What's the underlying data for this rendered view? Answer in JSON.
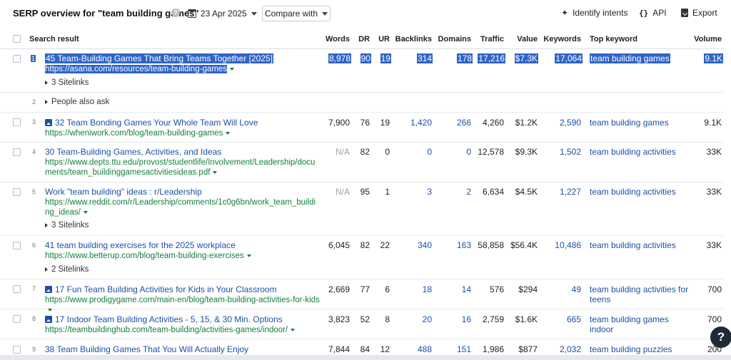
{
  "header": {
    "title": "SERP overview for \"team building games\"",
    "help_icon": "?",
    "date": "23 Apr 2025",
    "compare_label": "Compare with",
    "identify_label": "Identify intents",
    "api_label": "API",
    "api_icon_glyph": "{}",
    "export_label": "Export"
  },
  "columns": {
    "search_result": "Search result",
    "words": "Words",
    "dr": "DR",
    "ur": "UR",
    "backlinks": "Backlinks",
    "domains": "Domains",
    "traffic": "Traffic",
    "value": "Value",
    "keywords": "Keywords",
    "top_keyword": "Top keyword",
    "volume": "Volume"
  },
  "rows": [
    {
      "num": "1",
      "title": "45 Team-Building Games That Bring Teams Together [2025]",
      "url": "https://asana.com/resources/team-building-games",
      "sitelinks": "3 Sitelinks",
      "words": "8,978",
      "dr": "90",
      "ur": "19",
      "backlinks": "314",
      "domains": "178",
      "traffic": "17,216",
      "value": "$7.3K",
      "keywords": "17,064",
      "top_keyword": "team building games",
      "volume": "9.1K"
    },
    {
      "num": "2",
      "paa": "People also ask"
    },
    {
      "num": "3",
      "title": "32 Team Bonding Games Your Whole Team Will Love",
      "url": "https://wheniwork.com/blog/team-building-games",
      "words": "7,900",
      "dr": "76",
      "ur": "19",
      "backlinks": "1,420",
      "domains": "266",
      "traffic": "4,260",
      "value": "$1.2K",
      "keywords": "2,590",
      "top_keyword": "team building games",
      "volume": "9.1K"
    },
    {
      "num": "4",
      "title": "30 Team-Building Games, Activities, and Ideas",
      "url": "https://www.depts.ttu.edu/provost/studentlife/Involvement/Leadership/documents/team_buildinggamesactivitiesideas.pdf",
      "words": "N/A",
      "dr": "82",
      "ur": "0",
      "backlinks": "0",
      "domains": "0",
      "traffic": "12,578",
      "value": "$9.3K",
      "keywords": "1,502",
      "top_keyword": "team building activities",
      "volume": "33K"
    },
    {
      "num": "5",
      "title": "Work \"team building\" ideas : r/Leadership",
      "url": "https://www.reddit.com/r/Leadership/comments/1c0g6bn/work_team_building_ideas/",
      "sitelinks": "3 Sitelinks",
      "words": "N/A",
      "dr": "95",
      "ur": "1",
      "backlinks": "3",
      "domains": "2",
      "traffic": "6,634",
      "value": "$4.5K",
      "keywords": "1,227",
      "top_keyword": "team building activities",
      "volume": "33K"
    },
    {
      "num": "6",
      "title": "41 team building exercises for the 2025 workplace",
      "url": "https://www.betterup.com/blog/team-building-exercises",
      "sitelinks": "2 Sitelinks",
      "words": "6,045",
      "dr": "82",
      "ur": "22",
      "backlinks": "340",
      "domains": "163",
      "traffic": "58,858",
      "value": "$56.4K",
      "keywords": "10,486",
      "top_keyword": "team building activities",
      "volume": "33K"
    },
    {
      "num": "7",
      "title": "17 Fun Team Building Activities for Kids in Your Classroom",
      "url": "https://www.prodigygame.com/main-en/blog/team-building-activities-for-kids",
      "words": "2,669",
      "dr": "77",
      "ur": "6",
      "backlinks": "18",
      "domains": "14",
      "traffic": "576",
      "value": "$294",
      "keywords": "49",
      "top_keyword": "team building activities for teens",
      "volume": "700"
    },
    {
      "num": "8",
      "title": "17 Indoor Team Building Activities - 5, 15, & 30 Min. Options",
      "url": "https://teambuildinghub.com/team-building/activities-games/indoor/",
      "words": "3,823",
      "dr": "52",
      "ur": "8",
      "backlinks": "20",
      "domains": "16",
      "traffic": "2,759",
      "value": "$1.6K",
      "keywords": "665",
      "top_keyword": "team building games indoor",
      "volume": "700"
    },
    {
      "num": "9",
      "title": "38 Team Building Games That You Will Actually Enjoy",
      "words": "7,844",
      "dr": "84",
      "ur": "12",
      "backlinks": "488",
      "domains": "151",
      "traffic": "1,986",
      "value": "$877",
      "keywords": "2,032",
      "top_keyword": "team building puzzles",
      "volume": "200"
    }
  ],
  "help_fab": "?",
  "colors": {
    "link": "#1d4fa8",
    "url": "#15803d",
    "selection": "#2f64c6"
  }
}
